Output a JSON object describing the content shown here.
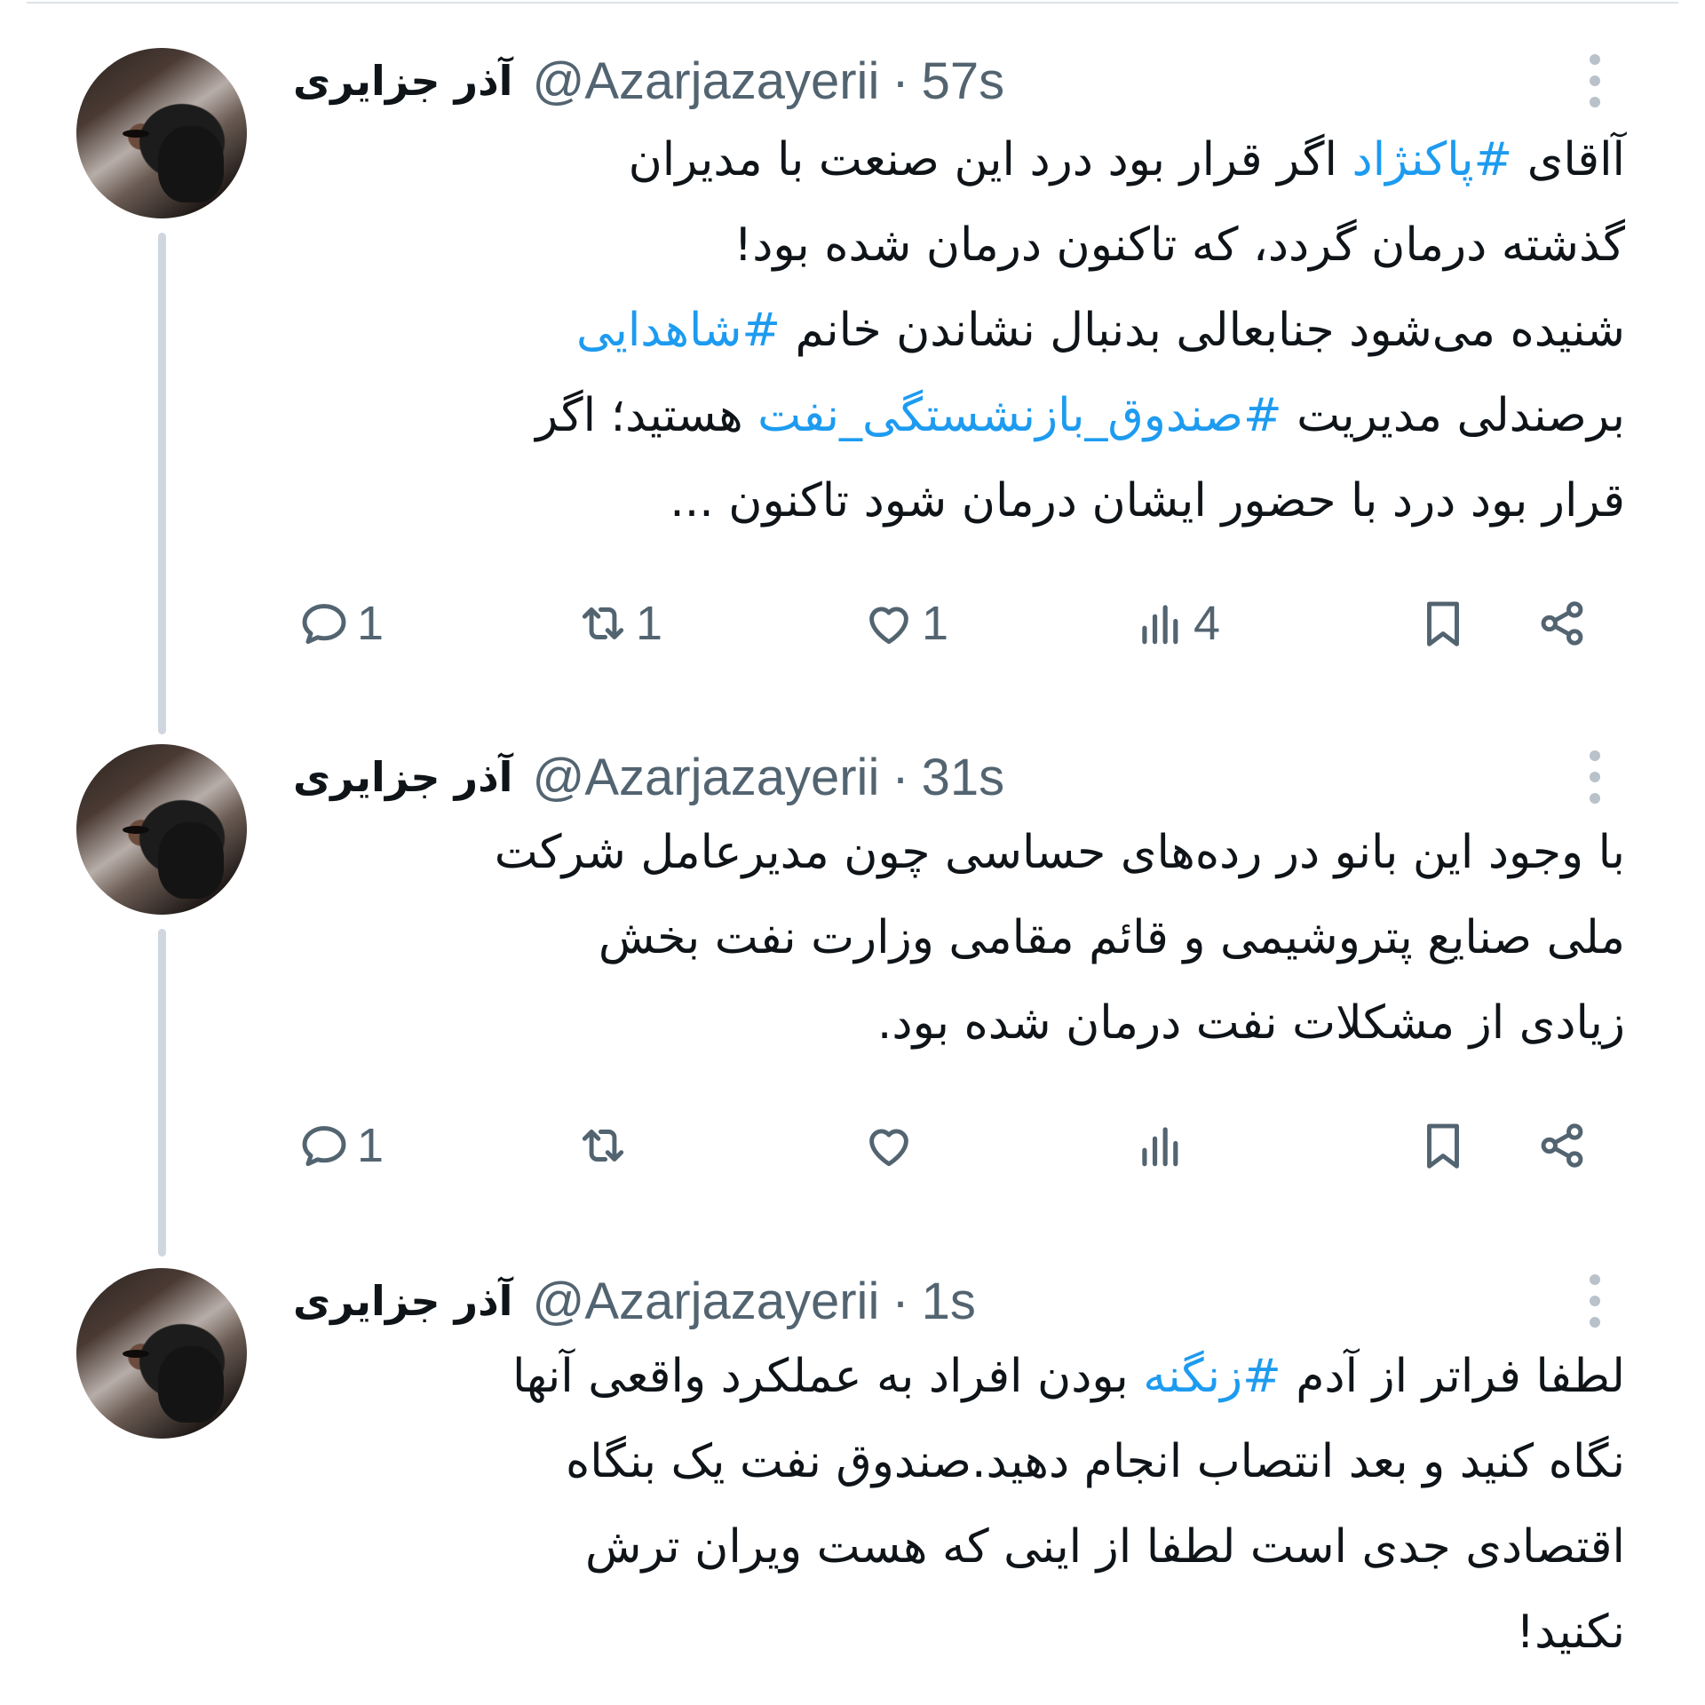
{
  "colors": {
    "accent": "#1d9bf0",
    "secondary_text": "#536471",
    "primary_text": "#0f1419",
    "thread_line": "#cfd6dd"
  },
  "icons": [
    "reply-icon",
    "retweet-icon",
    "like-icon",
    "views-icon",
    "bookmark-icon",
    "share-icon",
    "more-options-icon"
  ],
  "tweets": [
    {
      "name": "آذر جزایری",
      "handle": "@Azarjazayerii",
      "separator": "·",
      "time": "57s",
      "lines": [
        [
          {
            "t": "آاقای "
          },
          {
            "t": "#پاکنژاد",
            "tag": true
          },
          {
            "t": "  اگر قرار بود درد این صنعت با مدیران"
          }
        ],
        [
          {
            "t": "گذشته درمان گردد، که تاکنون درمان شده بود!"
          }
        ],
        [
          {
            "t": "شنیده می‌شود جنابعالی بدنبال نشاندن خانم "
          },
          {
            "t": "#شاهدایی",
            "tag": true
          }
        ],
        [
          {
            "t": "برصندلی مدیریت "
          },
          {
            "t": "#صندوق_بازنشستگی_نفت",
            "tag": true
          },
          {
            "t": " هستید؛ اگر"
          }
        ],
        [
          {
            "t": "قرار بود درد با حضور ایشان درمان شود تاکنون ..."
          }
        ]
      ],
      "replies": "1",
      "retweets": "1",
      "likes": "1",
      "views": "4"
    },
    {
      "name": "آذر جزایری",
      "handle": "@Azarjazayerii",
      "separator": "·",
      "time": "31s",
      "lines": [
        [
          {
            "t": "با وجود این بانو در رده‌های حساسی چون مدیرعامل شرکت"
          }
        ],
        [
          {
            "t": "ملی صنایع پتروشیمی و قائم مقامی وزارت نفت بخش"
          }
        ],
        [
          {
            "t": "زیادی از مشکلات نفت درمان شده بود."
          }
        ]
      ],
      "replies": "1",
      "retweets": "",
      "likes": "",
      "views": ""
    },
    {
      "name": "آذر جزایری",
      "handle": "@Azarjazayerii",
      "separator": "·",
      "time": "1s",
      "lines": [
        [
          {
            "t": "لطفا فراتر از آدم "
          },
          {
            "t": "#زنگنه",
            "tag": true
          },
          {
            "t": " بودن افراد به عملکرد واقعی آنها"
          }
        ],
        [
          {
            "t": "نگاه کنید و بعد انتصاب انجام دهید.صندوق نفت یک بنگاه"
          }
        ],
        [
          {
            "t": "اقتصادی جدی است لطفا از اینی که هست ویران ترش"
          }
        ],
        [
          {
            "t": "نکنید!"
          }
        ]
      ]
    }
  ]
}
